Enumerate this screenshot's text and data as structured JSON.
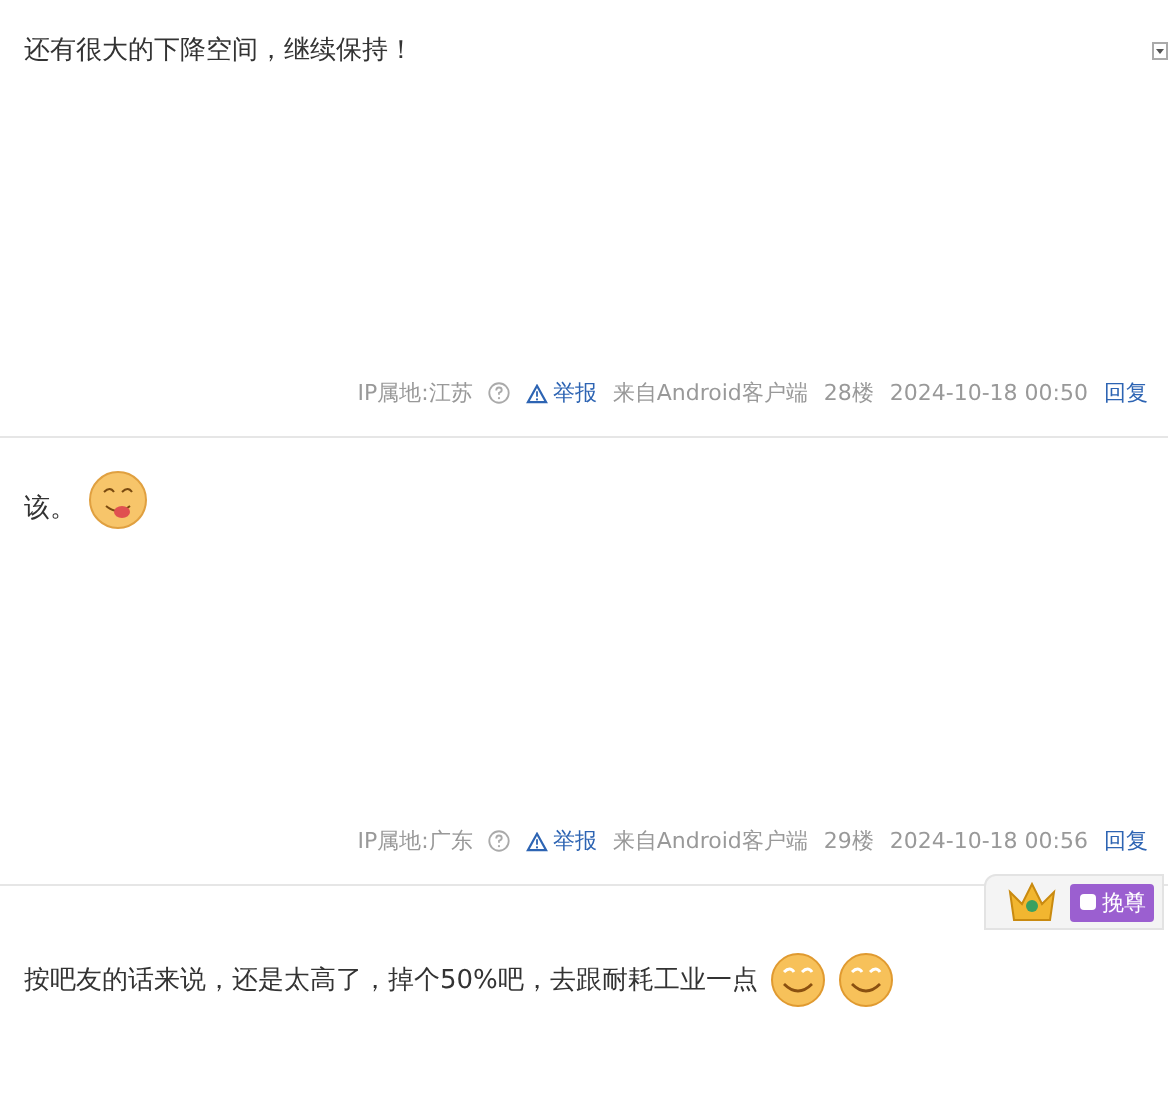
{
  "posts": [
    {
      "text": "还有很大的下降空间，继续保持！",
      "footer": {
        "ip": "IP属地:江苏",
        "report": "举报",
        "client": "来自Android客户端",
        "floor": "28楼",
        "time": "2024-10-18 00:50",
        "reply": "回复"
      }
    },
    {
      "text": "该。",
      "emojis": [
        {
          "kind": "tongue"
        }
      ],
      "footer": {
        "ip": "IP属地:广东",
        "report": "举报",
        "client": "来自Android客户端",
        "floor": "29楼",
        "time": "2024-10-18 00:56",
        "reply": "回复"
      }
    },
    {
      "text": "按吧友的话来说，还是太高了，掉个50%吧，去跟耐耗工业一点",
      "emojis": [
        {
          "kind": "smile"
        },
        {
          "kind": "smile"
        }
      ],
      "badge": "挽尊"
    }
  ]
}
